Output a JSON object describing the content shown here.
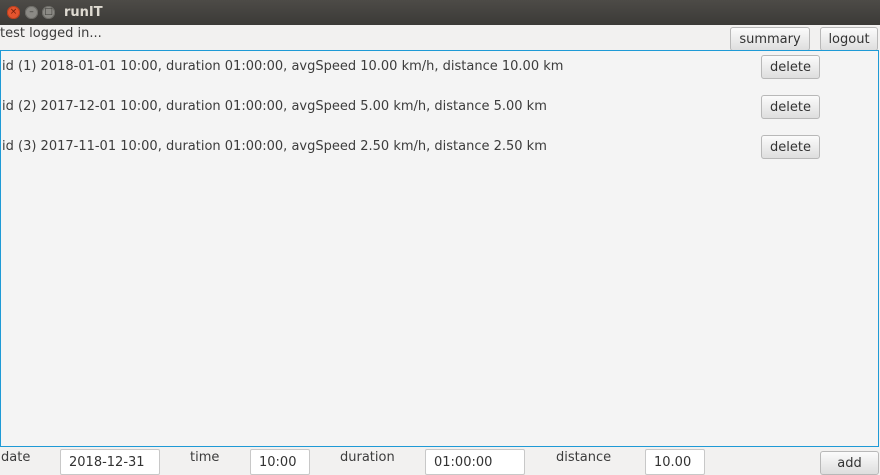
{
  "window": {
    "title": "runIT",
    "close_glyph": "×",
    "min_glyph": "–",
    "max_glyph": "□"
  },
  "status_text": "test logged in...",
  "toolbar": {
    "summary_label": "summary",
    "logout_label": "logout"
  },
  "runs": [
    {
      "text": "id (1) 2018-01-01 10:00, duration 01:00:00, avgSpeed 10.00 km/h, distance 10.00 km",
      "delete_label": "delete"
    },
    {
      "text": "id (2) 2017-12-01 10:00, duration 01:00:00, avgSpeed 5.00 km/h, distance 5.00 km",
      "delete_label": "delete"
    },
    {
      "text": "id (3) 2017-11-01 10:00, duration 01:00:00, avgSpeed 2.50 km/h, distance 2.50 km",
      "delete_label": "delete"
    }
  ],
  "form": {
    "date_label": "date",
    "date_value": "2018-12-31",
    "time_label": "time",
    "time_value": "10:00",
    "duration_label": "duration",
    "duration_value": "01:00:00",
    "distance_label": "distance",
    "distance_value": "10.00",
    "add_label": "add"
  },
  "colors": {
    "accent": "#1e9ad6",
    "close": "#e4542e",
    "titlebar": "#3c3b37"
  }
}
